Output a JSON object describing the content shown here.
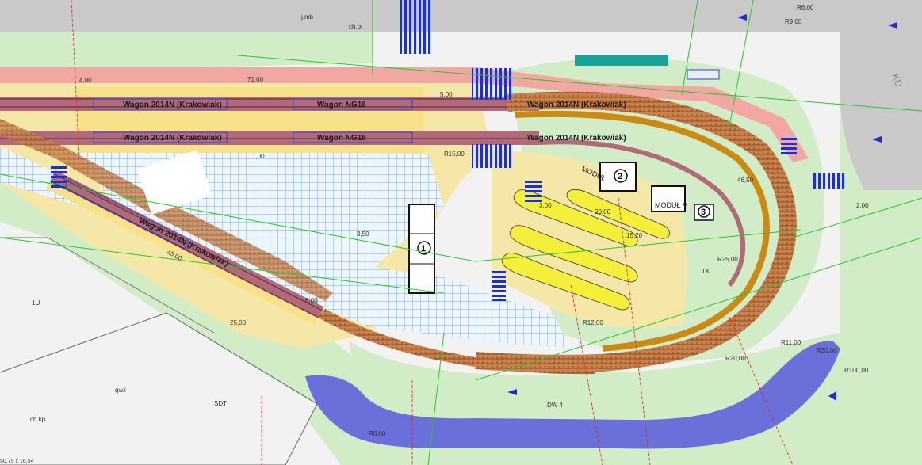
{
  "wagons": {
    "top_left": "Wagon 2014N (Krakowiak)",
    "top_right": "Wagon NG16",
    "mid_left": "Wagon 2014N (Krakowiak)",
    "mid_right": "Wagon NG16",
    "diag": "Wagon 2014N (Krakowiak)",
    "loop_a": "Wagon 2014N (Krakowiak)",
    "loop_b": "Wagon 2014N (Krakowiak)"
  },
  "modules": {
    "m1": "1",
    "m2": "2",
    "m3": "3",
    "modul": "MODUŁ",
    "modul_v": "MODUŁ V"
  },
  "labels": {
    "dw4": "DW 4",
    "kd": "KD",
    "r15": "R15,00",
    "r25": "R25,00",
    "r8": "R8,00",
    "r100": "R100,00",
    "r30": "R30,00",
    "r20": "R20,00",
    "r12": "R12,00",
    "r11": "R11,00",
    "r9": "R9,00",
    "r6": "R6,00",
    "d400": "4,00",
    "d500": "5,00",
    "d600": "6,00",
    "d350": "3,50",
    "d300": "3,00",
    "d200": "2,00",
    "d100": "1,00",
    "d2500": "25,00",
    "d4500": "45,00",
    "d7100": "71,00",
    "d4650": "46,50",
    "d1520": "15,20",
    "d2000": "20,00",
    "chbt": "ch.bt",
    "jmb": "j.mb",
    "chkp": "ch.kp",
    "qwi": "qw.i",
    "sdt": "SDT",
    "tk": "TK",
    "lu": "1U"
  },
  "status_bar": "50,79 x 16,54"
}
